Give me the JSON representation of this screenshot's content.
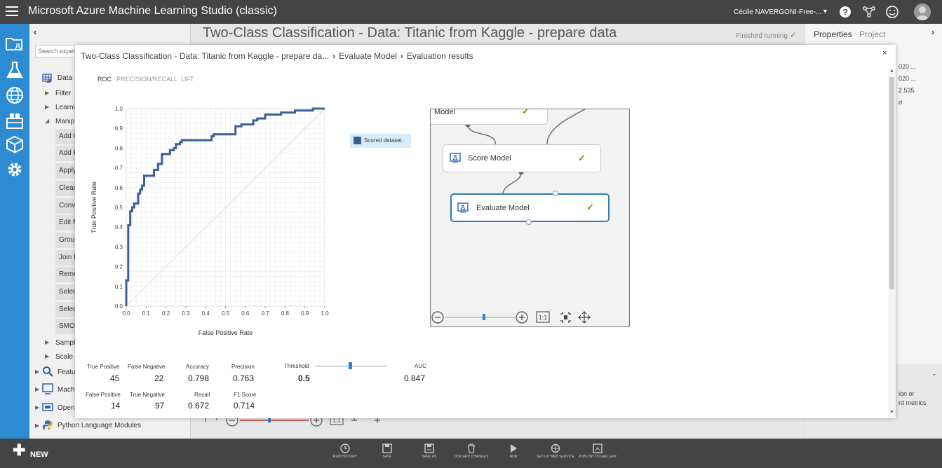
{
  "app": {
    "title": "Microsoft Azure Machine Learning Studio (classic)",
    "user": "Cécile NAVERGONI-Free-..."
  },
  "palette": {
    "search_placeholder": "Search exper",
    "items": [
      {
        "label": "Data",
        "top": 0
      },
      {
        "label": "Filter"
      },
      {
        "label": "Learni"
      },
      {
        "label": "Manip"
      },
      {
        "label": "Sampl"
      },
      {
        "label": "Scale a"
      },
      {
        "label": "Featu"
      },
      {
        "label": "Mach"
      },
      {
        "label": "Open"
      },
      {
        "label": "Python Language Modules"
      }
    ],
    "modules": [
      "Add C",
      "Add R",
      "Apply",
      "Clean",
      "Conv",
      "Edit M",
      "Grou",
      "Join D",
      "Remo",
      "Selec",
      "Selec",
      "SMOT"
    ]
  },
  "experiment": {
    "title": "Two-Class Classification - Data: Titanic from Kaggle - prepare data",
    "status": "Finished running"
  },
  "right_panel": {
    "tab_properties": "Properties",
    "tab_project": "Project",
    "fragments": [
      "020 ...",
      "020 ...",
      "2.535",
      "d",
      "ion or",
      "rd metrics"
    ]
  },
  "modal": {
    "breadcrumb": [
      "Two-Class Classification - Data: Titanic from Kaggle - prepare da...",
      "Evaluate Model",
      "Evaluation results"
    ],
    "close_label": "×",
    "tabs": [
      "ROC",
      "PRECISION/RECALL",
      "LIFT"
    ],
    "legend": "Scored dataset",
    "graph": {
      "partial_module": "Model",
      "score_module": "Score Model",
      "evaluate_module": "Evaluate Model",
      "zoom_reset": "1:1"
    },
    "metrics": {
      "true_positive_label": "True Positive",
      "true_positive": "45",
      "false_negative_label": "False Negative",
      "false_negative": "22",
      "false_positive_label": "False Positive",
      "false_positive": "14",
      "true_negative_label": "True Negative",
      "true_negative": "97",
      "accuracy_label": "Accuracy",
      "accuracy": "0.798",
      "precision_label": "Precision",
      "precision": "0.763",
      "recall_label": "Recall",
      "recall": "0.672",
      "f1_label": "F1 Score",
      "f1": "0.714",
      "threshold_label": "Threshold",
      "threshold": "0.5",
      "auc_label": "AUC",
      "auc": "0.847"
    }
  },
  "chart_data": {
    "type": "line",
    "title": "",
    "xlabel": "False Positive Rate",
    "ylabel": "True Positive Rate",
    "xlim": [
      0,
      1
    ],
    "ylim": [
      0,
      1
    ],
    "x_ticks": [
      "0.0",
      "0.1",
      "0.2",
      "0.3",
      "0.4",
      "0.5",
      "0.6",
      "0.7",
      "0.8",
      "0.9",
      "1.0"
    ],
    "y_ticks": [
      "0.0",
      "0.1",
      "0.2",
      "0.3",
      "0.4",
      "0.5",
      "0.6",
      "0.7",
      "0.8",
      "0.9",
      "1.0"
    ],
    "grid": true,
    "series": [
      {
        "name": "Scored dataset",
        "color": "#3c5f99",
        "x": [
          0.0,
          0.0,
          0.01,
          0.01,
          0.02,
          0.02,
          0.03,
          0.03,
          0.04,
          0.04,
          0.06,
          0.06,
          0.07,
          0.07,
          0.08,
          0.08,
          0.09,
          0.09,
          0.14,
          0.14,
          0.16,
          0.16,
          0.18,
          0.18,
          0.22,
          0.22,
          0.24,
          0.24,
          0.25,
          0.25,
          0.27,
          0.27,
          0.28,
          0.28,
          0.43,
          0.43,
          0.44,
          0.44,
          0.55,
          0.55,
          0.58,
          0.58,
          0.64,
          0.64,
          0.66,
          0.66,
          0.7,
          0.7,
          0.78,
          0.78,
          0.85,
          0.85,
          0.94,
          0.94,
          1.0
        ],
        "y": [
          0.0,
          0.13,
          0.13,
          0.41,
          0.41,
          0.48,
          0.48,
          0.5,
          0.5,
          0.52,
          0.52,
          0.57,
          0.57,
          0.59,
          0.59,
          0.61,
          0.61,
          0.66,
          0.66,
          0.69,
          0.69,
          0.72,
          0.72,
          0.77,
          0.77,
          0.79,
          0.79,
          0.8,
          0.8,
          0.82,
          0.82,
          0.83,
          0.83,
          0.84,
          0.84,
          0.86,
          0.86,
          0.87,
          0.87,
          0.91,
          0.91,
          0.92,
          0.92,
          0.94,
          0.94,
          0.95,
          0.95,
          0.97,
          0.97,
          0.98,
          0.98,
          0.99,
          0.99,
          1.0,
          1.0
        ]
      },
      {
        "name": "",
        "color": "#dddddd",
        "x": [
          0.0,
          1.0
        ],
        "y": [
          0.0,
          1.0
        ]
      }
    ]
  },
  "bottom_bar": {
    "new_label": "NEW",
    "buttons": [
      "RUN HISTORY",
      "SAVE",
      "SAVE AS",
      "DISCARD CHANGES",
      "RUN",
      "SET UP WEB SERVICE",
      "PUBLISH TO GALLERY"
    ]
  }
}
